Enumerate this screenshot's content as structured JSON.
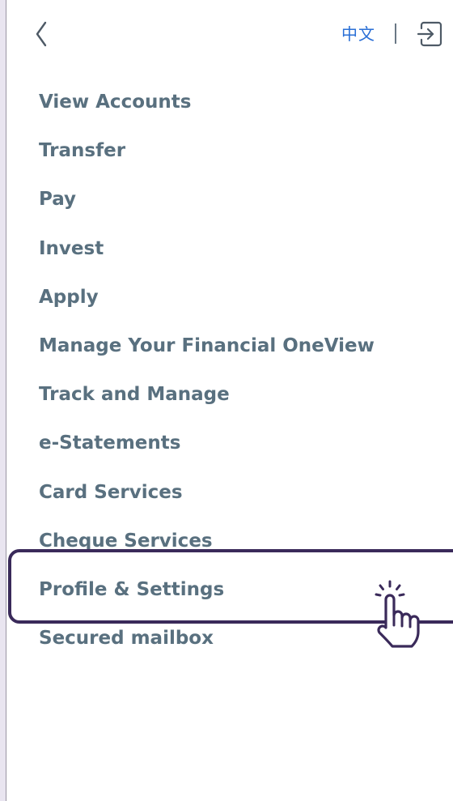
{
  "header": {
    "back_icon": "chevron-left-icon",
    "language_label": "中文",
    "logout_icon": "logout-icon",
    "link_color": "#2a6fd6"
  },
  "menu": {
    "text_color": "#59707f",
    "items": [
      {
        "label": "View Accounts"
      },
      {
        "label": "Transfer"
      },
      {
        "label": "Pay"
      },
      {
        "label": "Invest"
      },
      {
        "label": "Apply"
      },
      {
        "label": "Manage Your Financial OneView"
      },
      {
        "label": "Track and Manage"
      },
      {
        "label": "e-Statements"
      },
      {
        "label": "Card Services"
      },
      {
        "label": "Cheque Services"
      },
      {
        "label": "Profile & Settings",
        "highlighted": true
      },
      {
        "label": "Secured mailbox"
      }
    ]
  },
  "annotation": {
    "highlight_color": "#3a2a5a",
    "pointer_icon": "tap-hand-icon"
  }
}
